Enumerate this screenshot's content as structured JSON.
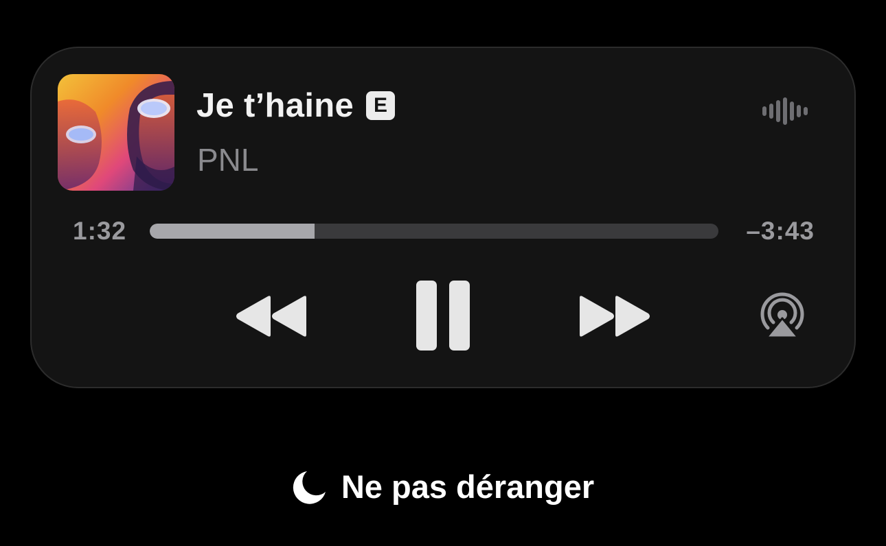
{
  "now_playing": {
    "title": "Je t’haine",
    "explicit_badge": "E",
    "artist": "PNL",
    "artwork_icon": "album-artwork",
    "elapsed": "1:32",
    "remaining": "–3:43",
    "progress_fraction": 0.29
  },
  "controls": {
    "rewind_icon": "rewind-icon",
    "pause_icon": "pause-icon",
    "forward_icon": "fast-forward-icon",
    "airplay_icon": "airplay-audio-icon",
    "waveform_icon": "audio-waveform-icon"
  },
  "focus": {
    "icon": "moon-icon",
    "label": "Ne pas déranger"
  },
  "colors": {
    "background": "#000000",
    "card": "#141414",
    "primary_text": "#f2f2f2",
    "secondary_text": "#8a8a8e",
    "track": "#3a3a3c",
    "fill": "#a7a7ab"
  }
}
